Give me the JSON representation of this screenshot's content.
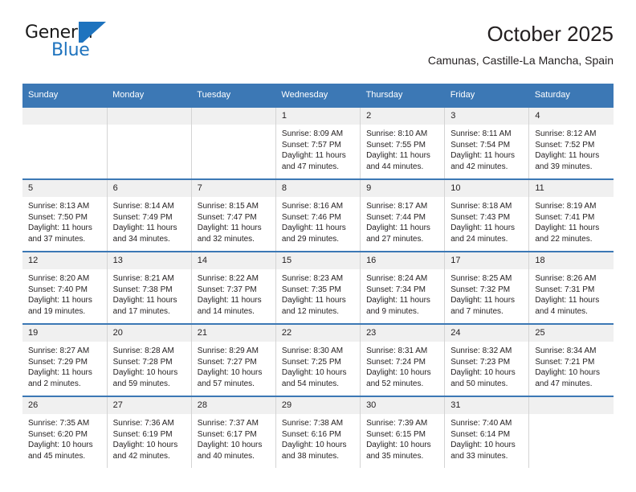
{
  "brand": {
    "name_top": "General",
    "name_bottom": "Blue",
    "mark": "triangle-logo",
    "color_blue": "#1e73be",
    "color_dark": "#1a1a1a"
  },
  "header": {
    "title": "October 2025",
    "subtitle": "Camunas, Castille-La Mancha, Spain"
  },
  "theme": {
    "header_blue": "#3c78b5",
    "daynum_band": "#f0f0f0",
    "cell_border": "#d4d4d4",
    "text": "#231f20"
  },
  "weekdays": [
    "Sunday",
    "Monday",
    "Tuesday",
    "Wednesday",
    "Thursday",
    "Friday",
    "Saturday"
  ],
  "weeks": [
    [
      {
        "day": "",
        "empty": true
      },
      {
        "day": "",
        "empty": true
      },
      {
        "day": "",
        "empty": true
      },
      {
        "day": "1",
        "sunrise": "Sunrise: 8:09 AM",
        "sunset": "Sunset: 7:57 PM",
        "daylight1": "Daylight: 11 hours",
        "daylight2": "and 47 minutes."
      },
      {
        "day": "2",
        "sunrise": "Sunrise: 8:10 AM",
        "sunset": "Sunset: 7:55 PM",
        "daylight1": "Daylight: 11 hours",
        "daylight2": "and 44 minutes."
      },
      {
        "day": "3",
        "sunrise": "Sunrise: 8:11 AM",
        "sunset": "Sunset: 7:54 PM",
        "daylight1": "Daylight: 11 hours",
        "daylight2": "and 42 minutes."
      },
      {
        "day": "4",
        "sunrise": "Sunrise: 8:12 AM",
        "sunset": "Sunset: 7:52 PM",
        "daylight1": "Daylight: 11 hours",
        "daylight2": "and 39 minutes."
      }
    ],
    [
      {
        "day": "5",
        "sunrise": "Sunrise: 8:13 AM",
        "sunset": "Sunset: 7:50 PM",
        "daylight1": "Daylight: 11 hours",
        "daylight2": "and 37 minutes."
      },
      {
        "day": "6",
        "sunrise": "Sunrise: 8:14 AM",
        "sunset": "Sunset: 7:49 PM",
        "daylight1": "Daylight: 11 hours",
        "daylight2": "and 34 minutes."
      },
      {
        "day": "7",
        "sunrise": "Sunrise: 8:15 AM",
        "sunset": "Sunset: 7:47 PM",
        "daylight1": "Daylight: 11 hours",
        "daylight2": "and 32 minutes."
      },
      {
        "day": "8",
        "sunrise": "Sunrise: 8:16 AM",
        "sunset": "Sunset: 7:46 PM",
        "daylight1": "Daylight: 11 hours",
        "daylight2": "and 29 minutes."
      },
      {
        "day": "9",
        "sunrise": "Sunrise: 8:17 AM",
        "sunset": "Sunset: 7:44 PM",
        "daylight1": "Daylight: 11 hours",
        "daylight2": "and 27 minutes."
      },
      {
        "day": "10",
        "sunrise": "Sunrise: 8:18 AM",
        "sunset": "Sunset: 7:43 PM",
        "daylight1": "Daylight: 11 hours",
        "daylight2": "and 24 minutes."
      },
      {
        "day": "11",
        "sunrise": "Sunrise: 8:19 AM",
        "sunset": "Sunset: 7:41 PM",
        "daylight1": "Daylight: 11 hours",
        "daylight2": "and 22 minutes."
      }
    ],
    [
      {
        "day": "12",
        "sunrise": "Sunrise: 8:20 AM",
        "sunset": "Sunset: 7:40 PM",
        "daylight1": "Daylight: 11 hours",
        "daylight2": "and 19 minutes."
      },
      {
        "day": "13",
        "sunrise": "Sunrise: 8:21 AM",
        "sunset": "Sunset: 7:38 PM",
        "daylight1": "Daylight: 11 hours",
        "daylight2": "and 17 minutes."
      },
      {
        "day": "14",
        "sunrise": "Sunrise: 8:22 AM",
        "sunset": "Sunset: 7:37 PM",
        "daylight1": "Daylight: 11 hours",
        "daylight2": "and 14 minutes."
      },
      {
        "day": "15",
        "sunrise": "Sunrise: 8:23 AM",
        "sunset": "Sunset: 7:35 PM",
        "daylight1": "Daylight: 11 hours",
        "daylight2": "and 12 minutes."
      },
      {
        "day": "16",
        "sunrise": "Sunrise: 8:24 AM",
        "sunset": "Sunset: 7:34 PM",
        "daylight1": "Daylight: 11 hours",
        "daylight2": "and 9 minutes."
      },
      {
        "day": "17",
        "sunrise": "Sunrise: 8:25 AM",
        "sunset": "Sunset: 7:32 PM",
        "daylight1": "Daylight: 11 hours",
        "daylight2": "and 7 minutes."
      },
      {
        "day": "18",
        "sunrise": "Sunrise: 8:26 AM",
        "sunset": "Sunset: 7:31 PM",
        "daylight1": "Daylight: 11 hours",
        "daylight2": "and 4 minutes."
      }
    ],
    [
      {
        "day": "19",
        "sunrise": "Sunrise: 8:27 AM",
        "sunset": "Sunset: 7:29 PM",
        "daylight1": "Daylight: 11 hours",
        "daylight2": "and 2 minutes."
      },
      {
        "day": "20",
        "sunrise": "Sunrise: 8:28 AM",
        "sunset": "Sunset: 7:28 PM",
        "daylight1": "Daylight: 10 hours",
        "daylight2": "and 59 minutes."
      },
      {
        "day": "21",
        "sunrise": "Sunrise: 8:29 AM",
        "sunset": "Sunset: 7:27 PM",
        "daylight1": "Daylight: 10 hours",
        "daylight2": "and 57 minutes."
      },
      {
        "day": "22",
        "sunrise": "Sunrise: 8:30 AM",
        "sunset": "Sunset: 7:25 PM",
        "daylight1": "Daylight: 10 hours",
        "daylight2": "and 54 minutes."
      },
      {
        "day": "23",
        "sunrise": "Sunrise: 8:31 AM",
        "sunset": "Sunset: 7:24 PM",
        "daylight1": "Daylight: 10 hours",
        "daylight2": "and 52 minutes."
      },
      {
        "day": "24",
        "sunrise": "Sunrise: 8:32 AM",
        "sunset": "Sunset: 7:23 PM",
        "daylight1": "Daylight: 10 hours",
        "daylight2": "and 50 minutes."
      },
      {
        "day": "25",
        "sunrise": "Sunrise: 8:34 AM",
        "sunset": "Sunset: 7:21 PM",
        "daylight1": "Daylight: 10 hours",
        "daylight2": "and 47 minutes."
      }
    ],
    [
      {
        "day": "26",
        "sunrise": "Sunrise: 7:35 AM",
        "sunset": "Sunset: 6:20 PM",
        "daylight1": "Daylight: 10 hours",
        "daylight2": "and 45 minutes."
      },
      {
        "day": "27",
        "sunrise": "Sunrise: 7:36 AM",
        "sunset": "Sunset: 6:19 PM",
        "daylight1": "Daylight: 10 hours",
        "daylight2": "and 42 minutes."
      },
      {
        "day": "28",
        "sunrise": "Sunrise: 7:37 AM",
        "sunset": "Sunset: 6:17 PM",
        "daylight1": "Daylight: 10 hours",
        "daylight2": "and 40 minutes."
      },
      {
        "day": "29",
        "sunrise": "Sunrise: 7:38 AM",
        "sunset": "Sunset: 6:16 PM",
        "daylight1": "Daylight: 10 hours",
        "daylight2": "and 38 minutes."
      },
      {
        "day": "30",
        "sunrise": "Sunrise: 7:39 AM",
        "sunset": "Sunset: 6:15 PM",
        "daylight1": "Daylight: 10 hours",
        "daylight2": "and 35 minutes."
      },
      {
        "day": "31",
        "sunrise": "Sunrise: 7:40 AM",
        "sunset": "Sunset: 6:14 PM",
        "daylight1": "Daylight: 10 hours",
        "daylight2": "and 33 minutes."
      },
      {
        "day": "",
        "empty": true
      }
    ]
  ]
}
